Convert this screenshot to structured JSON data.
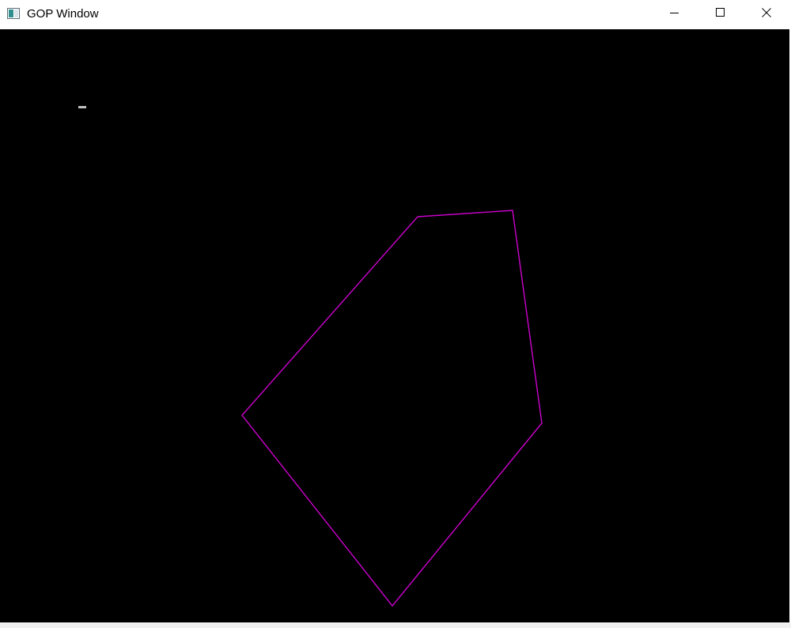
{
  "window": {
    "title": "GOP Window",
    "icons": {
      "app": "app-window-icon",
      "minimize": "minimize-icon",
      "maximize": "maximize-icon",
      "close": "close-icon"
    }
  },
  "canvas": {
    "background_color": "#000000",
    "polygon_color": "#cc00cc",
    "marker_color": "#c0c0c0"
  }
}
